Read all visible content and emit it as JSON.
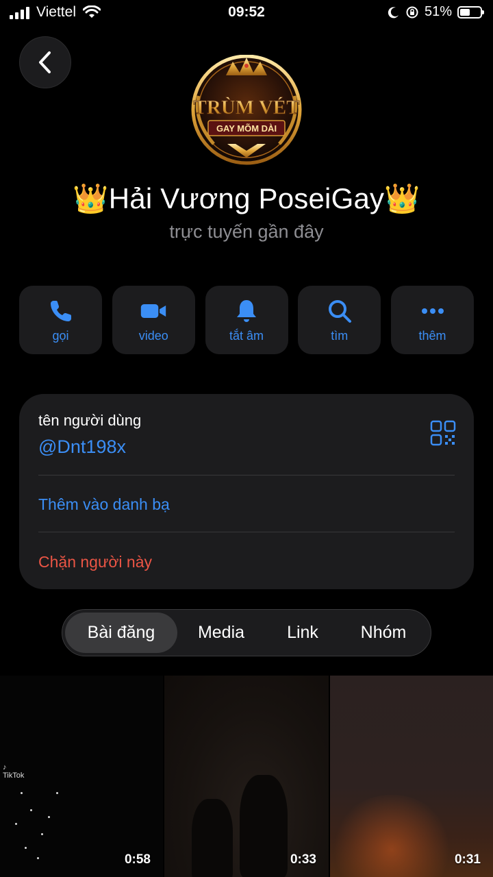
{
  "status_bar": {
    "carrier": "Viettel",
    "time": "09:52",
    "battery": "51%",
    "battery_level": 0.51
  },
  "avatar": {
    "title_line": "TRÙM VÉT",
    "subtitle_line": "GAY MÕM DÀI"
  },
  "profile": {
    "name": "👑Hải Vương PoseiGay👑",
    "status": "trực tuyến gần đây"
  },
  "actions": [
    {
      "label": "gọi",
      "icon": "phone-icon"
    },
    {
      "label": "video",
      "icon": "video-camera-icon"
    },
    {
      "label": "tắt âm",
      "icon": "bell-icon"
    },
    {
      "label": "tìm",
      "icon": "search-icon"
    },
    {
      "label": "thêm",
      "icon": "more-dots-icon"
    }
  ],
  "info": {
    "username_label": "tên người dùng",
    "username": "@Dnt198x",
    "add_contact": "Thêm vào danh bạ",
    "block": "Chặn người này"
  },
  "colors": {
    "accent": "#3b8ef5",
    "danger": "#eb5545",
    "card": "#1c1c1e"
  },
  "tabs": [
    {
      "label": "Bài đăng",
      "active": true
    },
    {
      "label": "Media",
      "active": false
    },
    {
      "label": "Link",
      "active": false
    },
    {
      "label": "Nhóm",
      "active": false
    }
  ],
  "media": [
    {
      "duration": "0:58",
      "watermark": "TikTok"
    },
    {
      "duration": "0:33"
    },
    {
      "duration": "0:31"
    }
  ]
}
